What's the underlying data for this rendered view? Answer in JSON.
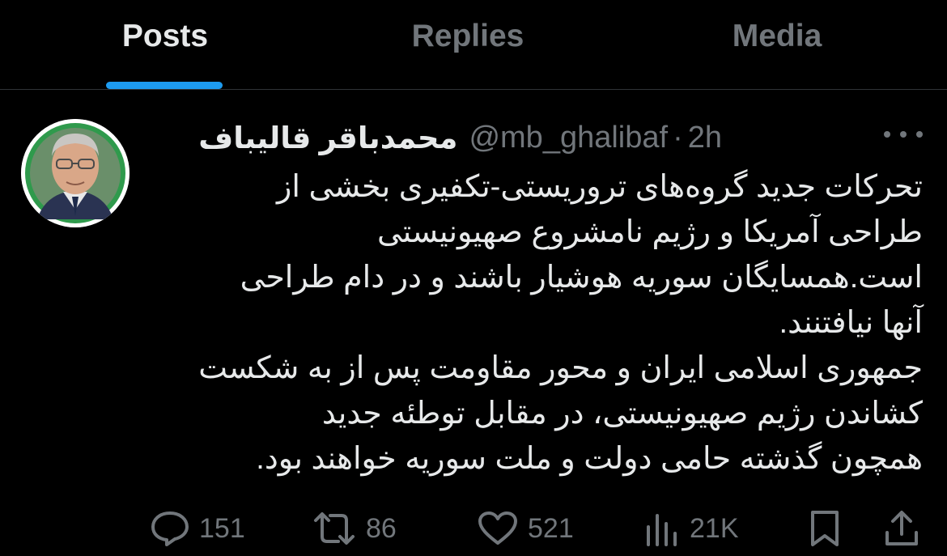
{
  "tabs": [
    {
      "label": "Posts",
      "active": true
    },
    {
      "label": "Replies",
      "active": false
    },
    {
      "label": "Media",
      "active": false
    }
  ],
  "tweet": {
    "display_name": "محمدباقر قالیباف",
    "handle": "@mb_ghalibaf",
    "separator": "·",
    "timestamp": "2h",
    "avatar_icon": "profile-photo",
    "lines": [
      "تحرکات جدید گروه‌های تروریستی-تکفیری بخشی از",
      "طراحی آمریکا و رژیم نامشروع صهیونیستی",
      "است.همسایگان سوریه هوشیار باشند و در دام طراحی",
      "آنها نیافتنند.",
      "جمهوری اسلامی ایران و محور مقاومت پس از به شکست",
      "کشاندن رژیم صهیونیستی، در مقابل توطئه جدید",
      "همچون گذشته حامی دولت و ملت سوریه خواهند بود."
    ]
  },
  "actions": {
    "replies": "151",
    "reposts": "86",
    "likes": "521",
    "views": "21K"
  },
  "colors": {
    "background": "#000000",
    "text": "#e7e9ea",
    "muted": "#71767b",
    "accent": "#1d9bf0",
    "divider": "#2f3336"
  }
}
